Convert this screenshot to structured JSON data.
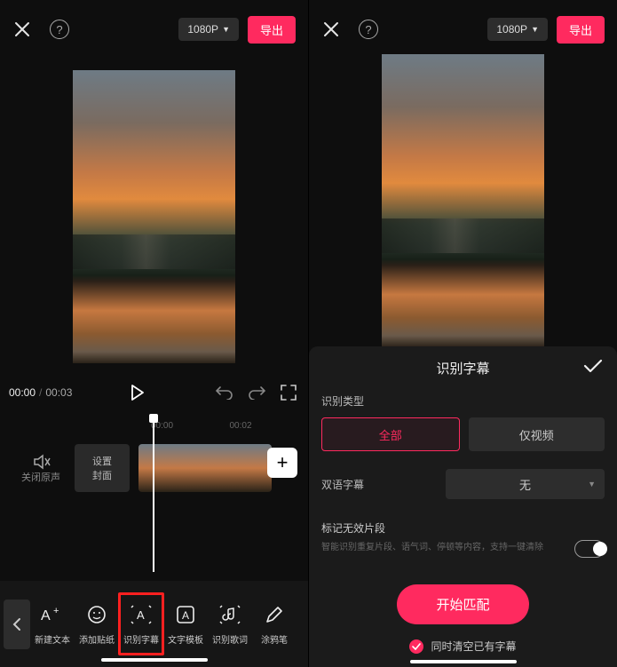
{
  "topbar": {
    "resolution": "1080P",
    "export": "导出"
  },
  "transport": {
    "current": "00:00",
    "total": "00:03"
  },
  "timeline": {
    "ticks": [
      "00:00",
      "00:02"
    ],
    "mute_label": "关闭原声",
    "cover_label": "设置\n封面",
    "add": "+"
  },
  "tools": [
    {
      "id": "new-text",
      "label": "新建文本"
    },
    {
      "id": "add-sticker",
      "label": "添加贴纸"
    },
    {
      "id": "recognize-subtitles",
      "label": "识别字幕"
    },
    {
      "id": "text-template",
      "label": "文字模板"
    },
    {
      "id": "recognize-lyrics",
      "label": "识别歌词"
    },
    {
      "id": "doodle",
      "label": "涂鸦笔"
    }
  ],
  "sheet": {
    "title": "识别字幕",
    "type_label": "识别类型",
    "seg_all": "全部",
    "seg_video": "仅视频",
    "bilingual_label": "双语字幕",
    "bilingual_value": "无",
    "mark_label": "标记无效片段",
    "mark_hint": "智能识别重复片段、语气词、停顿等内容，支持一键清除",
    "start": "开始匹配",
    "clear": "同时清空已有字幕"
  }
}
